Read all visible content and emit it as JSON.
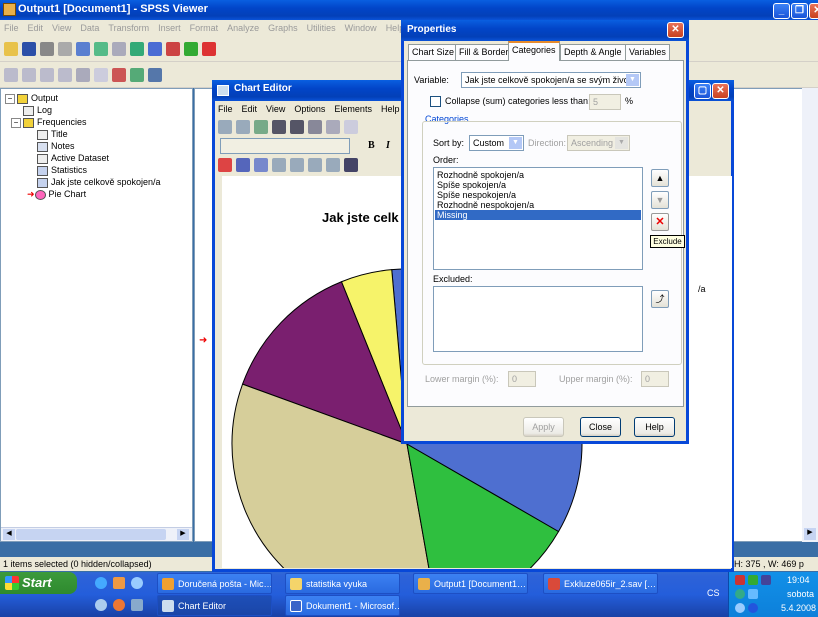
{
  "main_window": {
    "title": "Output1 [Document1] - SPSS Viewer",
    "menu": [
      "File",
      "Edit",
      "View",
      "Data",
      "Transform",
      "Insert",
      "Format",
      "Analyze",
      "Graphs",
      "Utilities",
      "Window",
      "Help"
    ],
    "status_left": "1 items selected (0 hidden/collapsed)",
    "status_right": "H: 375 , W: 469 p"
  },
  "outline": {
    "items": [
      {
        "label": "Output"
      },
      {
        "label": "Log"
      },
      {
        "label": "Frequencies"
      },
      {
        "label": "Title"
      },
      {
        "label": "Notes"
      },
      {
        "label": "Active Dataset"
      },
      {
        "label": "Statistics"
      },
      {
        "label": "Jak jste celkově spokojen/a"
      },
      {
        "label": "Pie Chart"
      }
    ]
  },
  "chart_editor": {
    "title": "Chart Editor",
    "menu": [
      "File",
      "Edit",
      "View",
      "Options",
      "Elements",
      "Help"
    ],
    "toolbar_text": [
      "B",
      "I"
    ],
    "chart_title": "Jak jste celk",
    "partial_label": "/a"
  },
  "pie_colors": {
    "khaki": "#d6ce9a",
    "purple": "#7a1f6f",
    "yellow": "#f6f36a",
    "green": "#2fbf3f",
    "blue": "#4e6fd0"
  },
  "properties": {
    "title": "Properties",
    "tabs": [
      "Chart Size",
      "Fill & Border",
      "Categories",
      "Depth & Angle",
      "Variables"
    ],
    "active_tab": "Categories",
    "variable_label": "Variable:",
    "variable_value": "Jak jste celkově spokojen/a se svým živo…",
    "collapse_label": "Collapse (sum) categories less than:",
    "collapse_value": "5",
    "collapse_unit": "%",
    "group_label": "Categories",
    "sortby_label": "Sort by:",
    "sortby_value": "Custom",
    "direction_label": "Direction:",
    "direction_value": "Ascending",
    "order_label": "Order:",
    "order_items": [
      "Rozhodně spokojen/a",
      "Spíše spokojen/a",
      "Spíše nespokojen/a",
      "Rozhodně nespokojen/a",
      "Missing"
    ],
    "selected_item": "Missing",
    "exclude_tooltip": "Exclude",
    "excluded_label": "Excluded:",
    "lower_margin_label": "Lower margin (%):",
    "lower_margin_value": "0",
    "upper_margin_label": "Upper margin (%):",
    "upper_margin_value": "0",
    "apply": "Apply",
    "close": "Close",
    "help": "Help"
  },
  "taskbar": {
    "start": "Start",
    "row1": [
      "Doručená pošta - Mic…",
      "statistika vyuka",
      "Output1 [Document1…",
      "Exkluze065ir_2.sav […"
    ],
    "row2": [
      "Chart Editor",
      "Dokument1 - Microsof…"
    ],
    "lang": "CS",
    "time": "19:04",
    "day": "sobota",
    "date": "5.4.2008"
  }
}
